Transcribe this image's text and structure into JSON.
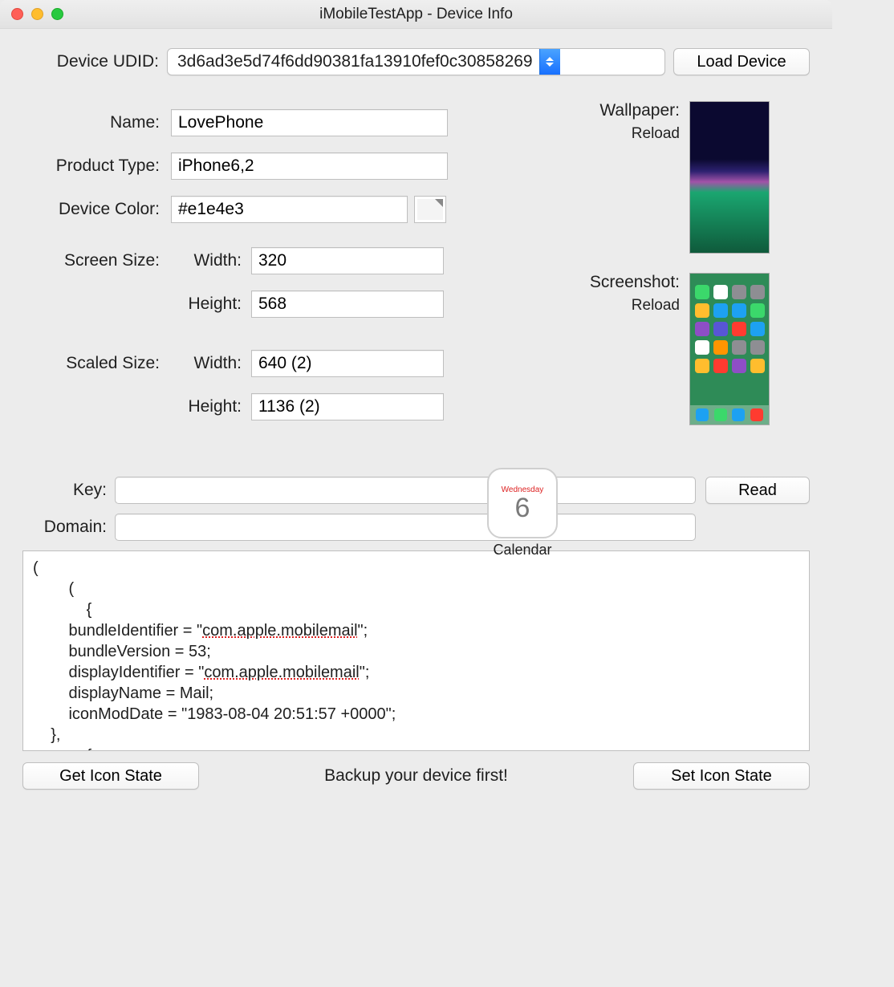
{
  "window": {
    "title": "iMobileTestApp - Device Info"
  },
  "top": {
    "udid_label": "Device UDID:",
    "udid_value": "3d6ad3e5d74f6dd90381fa13910fef0c30858269",
    "load_button": "Load Device"
  },
  "form": {
    "name_label": "Name:",
    "name_value": "LovePhone",
    "product_label": "Product Type:",
    "product_value": "iPhone6,2",
    "color_label": "Device Color:",
    "color_value": "#e1e4e3",
    "screen_label": "Screen Size:",
    "scaled_label": "Scaled Size:",
    "width_label": "Width:",
    "height_label": "Height:",
    "screen_width": "320",
    "screen_height": "568",
    "scaled_width": "640 (2)",
    "scaled_height": "1136 (2)"
  },
  "right": {
    "wallpaper_label": "Wallpaper:",
    "wallpaper_reload": "Reload",
    "screenshot_label": "Screenshot:",
    "screenshot_reload": "Reload"
  },
  "appicon": {
    "day": "Wednesday",
    "date": "6",
    "label": "Calendar"
  },
  "kv": {
    "key_label": "Key:",
    "key_value": "",
    "domain_label": "Domain:",
    "domain_value": "",
    "read_button": "Read"
  },
  "textarea": {
    "l1": "(",
    "l2": "        (",
    "l3": "            {",
    "l4a": "        bundleIdentifier = \"",
    "l4b": "com.apple.mobilemail",
    "l4c": "\";",
    "l5": "        bundleVersion = 53;",
    "l6a": "        displayIdentifier = \"",
    "l6b": "com.apple.mobilemail",
    "l6c": "\";",
    "l7": "        displayName = Mail;",
    "l8": "        iconModDate = \"1983-08-04 20:51:57 +0000\";",
    "l9": "    },",
    "l10": "            {"
  },
  "footer": {
    "get_button": "Get Icon State",
    "message": "Backup your device first!",
    "set_button": "Set Icon State"
  }
}
